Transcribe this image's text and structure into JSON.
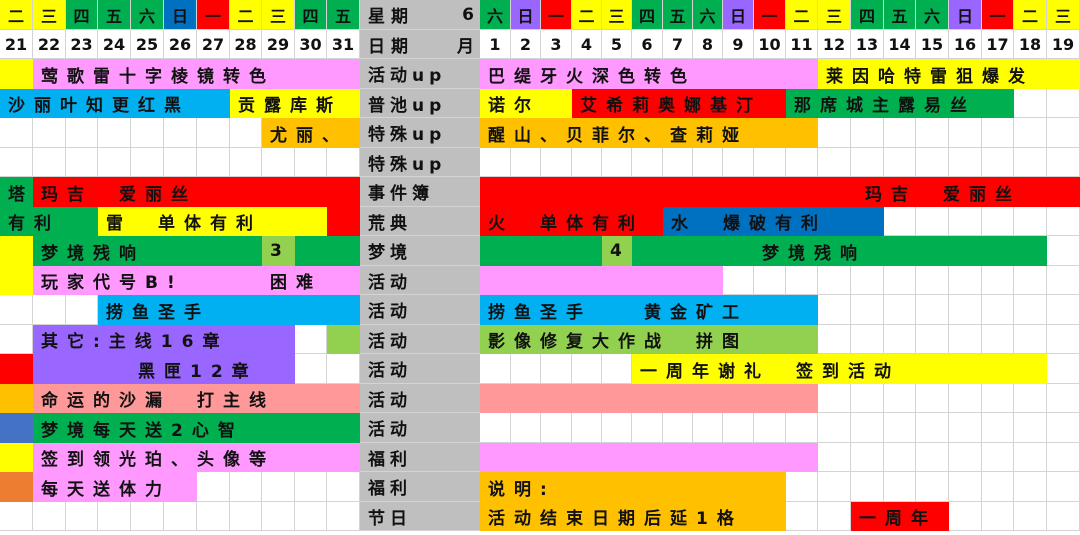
{
  "colors": {
    "yellow": "#ffff00",
    "green": "#00b050",
    "red": "#ff0000",
    "pink": "#ff99ff",
    "blue": "#0070c0",
    "cyan": "#00b0f0",
    "orange": "#ffc000",
    "purple": "#9966ff",
    "lightgreen": "#92d050",
    "salmon": "#ff9999",
    "steel": "#4472c4",
    "coral": "#ed7d31",
    "gray": "#bfbfbf"
  },
  "header": {
    "weekday_label": "星期",
    "weekday_num": "6",
    "date_label": "日期",
    "month_label": "月",
    "left_weekdays": [
      "二",
      "三",
      "四",
      "五",
      "六",
      "日",
      "一",
      "二",
      "三",
      "四",
      "五"
    ],
    "left_weekday_colors": [
      "yellow",
      "yellow",
      "green",
      "green",
      "green",
      "blue",
      "red",
      "yellow",
      "yellow",
      "green",
      "green"
    ],
    "left_dates": [
      "21",
      "22",
      "23",
      "24",
      "25",
      "26",
      "27",
      "28",
      "29",
      "30",
      "31"
    ],
    "right_weekdays": [
      "六",
      "日",
      "一",
      "二",
      "三",
      "四",
      "五",
      "六",
      "日",
      "一",
      "二",
      "三",
      "四",
      "五",
      "六",
      "日",
      "一",
      "二",
      "三"
    ],
    "right_weekday_colors": [
      "green",
      "purple",
      "red",
      "yellow",
      "yellow",
      "green",
      "green",
      "green",
      "purple",
      "red",
      "yellow",
      "yellow",
      "green",
      "green",
      "green",
      "purple",
      "red",
      "yellow",
      "yellow"
    ],
    "right_dates": [
      "1",
      "2",
      "3",
      "4",
      "5",
      "6",
      "7",
      "8",
      "9",
      "10",
      "11",
      "12",
      "13",
      "14",
      "15",
      "16",
      "17",
      "18",
      "19"
    ]
  },
  "labels": [
    "活动up",
    "普池up",
    "特殊up",
    "特殊up",
    "事件簿",
    "荒典",
    "梦境",
    "活动",
    "活动",
    "活动",
    "活动",
    "活动",
    "活动",
    "福利",
    "福利",
    "节日"
  ],
  "bars": [
    {
      "row": 0,
      "s": 0,
      "e": 0,
      "color": "yellow",
      "text": ""
    },
    {
      "row": 0,
      "s": 1,
      "e": 10,
      "color": "pink",
      "text": "莺歌雷十字棱镜转色"
    },
    {
      "row": 0,
      "s": 12,
      "e": 22,
      "color": "pink",
      "text": "巴缇牙火深色转色"
    },
    {
      "row": 0,
      "s": 23,
      "e": 30,
      "color": "yellow",
      "text": "莱因哈特雷狙爆发"
    },
    {
      "row": 1,
      "s": 0,
      "e": 6,
      "color": "cyan",
      "text": "沙丽叶知更红黑"
    },
    {
      "row": 1,
      "s": 7,
      "e": 10,
      "color": "yellow",
      "text": "贡露库斯"
    },
    {
      "row": 1,
      "s": 12,
      "e": 14,
      "color": "yellow",
      "text": "诺尔"
    },
    {
      "row": 1,
      "s": 15,
      "e": 21,
      "color": "red",
      "text": "艾希莉奥娜基汀"
    },
    {
      "row": 1,
      "s": 22,
      "e": 28,
      "color": "green",
      "text": "那席城主露易丝"
    },
    {
      "row": 2,
      "s": 8,
      "e": 10,
      "color": "orange",
      "text": "尤丽、"
    },
    {
      "row": 2,
      "s": 12,
      "e": 22,
      "color": "orange",
      "text": "醒山、贝菲尔、查莉娅"
    },
    {
      "row": 4,
      "s": 0,
      "e": 0,
      "color": "green",
      "text": "塔"
    },
    {
      "row": 4,
      "s": 1,
      "e": 10,
      "color": "red",
      "text": "玛吉　爱丽丝"
    },
    {
      "row": 4,
      "s": 12,
      "e": 30,
      "color": "red",
      "text": "玛吉　爱丽丝",
      "pad": "385px"
    },
    {
      "row": 5,
      "s": 0,
      "e": 2,
      "color": "green",
      "text": "有利"
    },
    {
      "row": 5,
      "s": 3,
      "e": 9,
      "color": "yellow",
      "text": "雷　单体有利"
    },
    {
      "row": 5,
      "s": 10,
      "e": 10,
      "color": "red",
      "text": ""
    },
    {
      "row": 5,
      "s": 12,
      "e": 17,
      "color": "red",
      "text": "火　单体有利"
    },
    {
      "row": 5,
      "s": 18,
      "e": 24,
      "color": "blue",
      "text": "水　爆破有利"
    },
    {
      "row": 6,
      "s": 0,
      "e": 0,
      "color": "yellow",
      "text": ""
    },
    {
      "row": 6,
      "s": 1,
      "e": 7,
      "color": "green",
      "text": "梦境残响"
    },
    {
      "row": 6,
      "s": 8,
      "e": 8,
      "color": "lightgreen",
      "text": "3"
    },
    {
      "row": 6,
      "s": 9,
      "e": 10,
      "color": "green",
      "text": ""
    },
    {
      "row": 6,
      "s": 12,
      "e": 15,
      "color": "green",
      "text": ""
    },
    {
      "row": 6,
      "s": 16,
      "e": 16,
      "color": "lightgreen",
      "text": "4"
    },
    {
      "row": 6,
      "s": 17,
      "e": 29,
      "color": "green",
      "text": "梦境残响",
      "pad": "130px"
    },
    {
      "row": 7,
      "s": 0,
      "e": 0,
      "color": "yellow",
      "text": ""
    },
    {
      "row": 7,
      "s": 1,
      "e": 7,
      "color": "pink",
      "text": "玩家代号B!"
    },
    {
      "row": 7,
      "s": 8,
      "e": 10,
      "color": "pink",
      "text": "困难"
    },
    {
      "row": 7,
      "s": 12,
      "e": 19,
      "color": "pink",
      "text": ""
    },
    {
      "row": 8,
      "s": 3,
      "e": 10,
      "color": "cyan",
      "text": "捞鱼圣手"
    },
    {
      "row": 8,
      "s": 12,
      "e": 22,
      "color": "cyan",
      "text": "捞鱼圣手　　黄金矿工"
    },
    {
      "row": 9,
      "s": 1,
      "e": 8,
      "color": "purple",
      "text": "其它:主线16章"
    },
    {
      "row": 9,
      "s": 10,
      "e": 10,
      "color": "lightgreen",
      "text": ""
    },
    {
      "row": 9,
      "s": 12,
      "e": 22,
      "color": "lightgreen",
      "text": "影像修复大作战　拼图"
    },
    {
      "row": 10,
      "s": 0,
      "e": 0,
      "color": "red",
      "text": ""
    },
    {
      "row": 10,
      "s": 1,
      "e": 8,
      "color": "purple",
      "text": "黑匣12章",
      "pad": "105px"
    },
    {
      "row": 10,
      "s": 17,
      "e": 29,
      "color": "yellow",
      "text": "一周年谢礼　签到活动"
    },
    {
      "row": 11,
      "s": 0,
      "e": 0,
      "color": "orange",
      "text": ""
    },
    {
      "row": 11,
      "s": 1,
      "e": 10,
      "color": "salmon",
      "text": "命运的沙漏　打主线"
    },
    {
      "row": 11,
      "s": 12,
      "e": 22,
      "color": "salmon",
      "text": ""
    },
    {
      "row": 12,
      "s": 0,
      "e": 0,
      "color": "steel",
      "text": ""
    },
    {
      "row": 12,
      "s": 1,
      "e": 10,
      "color": "green",
      "text": "梦境每天送2心智"
    },
    {
      "row": 13,
      "s": 0,
      "e": 0,
      "color": "yellow",
      "text": ""
    },
    {
      "row": 13,
      "s": 1,
      "e": 10,
      "color": "pink",
      "text": "签到领光珀、头像等"
    },
    {
      "row": 13,
      "s": 12,
      "e": 22,
      "color": "pink",
      "text": ""
    },
    {
      "row": 14,
      "s": 0,
      "e": 0,
      "color": "coral",
      "text": ""
    },
    {
      "row": 14,
      "s": 1,
      "e": 5,
      "color": "pink",
      "text": "每天送体力"
    },
    {
      "row": 14,
      "s": 12,
      "e": 21,
      "color": "orange",
      "text": "说明:"
    },
    {
      "row": 15,
      "s": 12,
      "e": 21,
      "color": "orange",
      "text": "活动结束日期后延1格"
    },
    {
      "row": 15,
      "s": 24,
      "e": 26,
      "color": "red",
      "text": "一周年"
    }
  ]
}
